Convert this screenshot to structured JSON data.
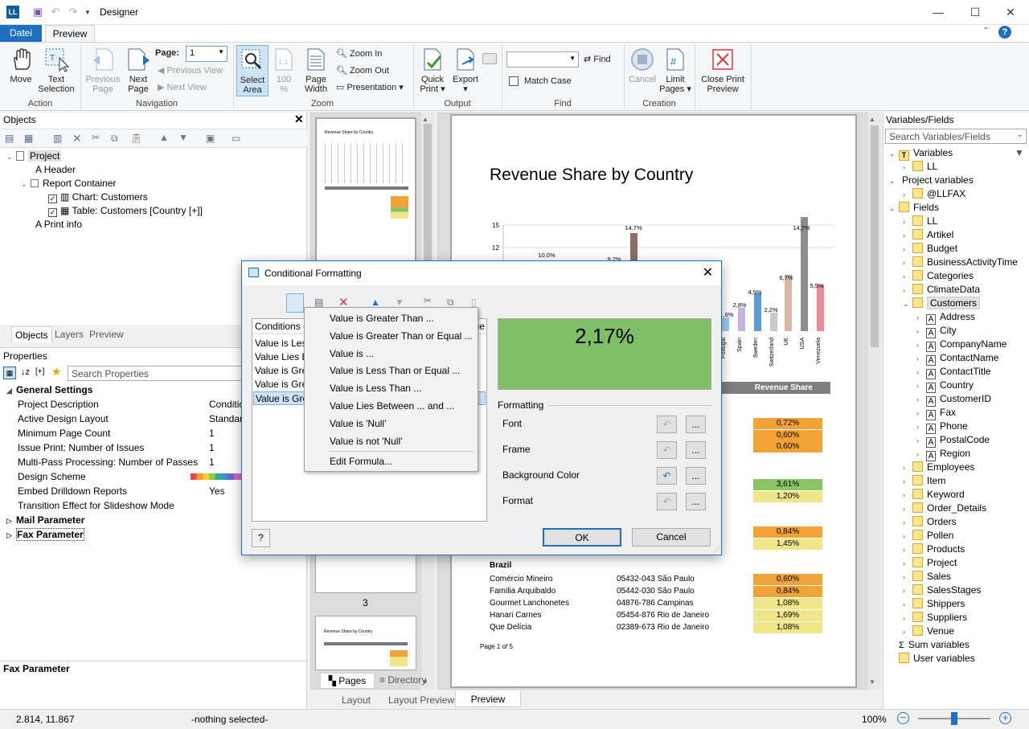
{
  "window": {
    "title": "Designer",
    "app_icon": "LL",
    "controls": [
      "—",
      "☐",
      "✕"
    ]
  },
  "ribbon_tabs": {
    "file": "Datei",
    "preview": "Preview"
  },
  "ribbon": {
    "move": "Move",
    "text_selection": [
      "Text",
      "Selection"
    ],
    "previous_page": [
      "Previous",
      "Page"
    ],
    "next_page": [
      "Next",
      "Page"
    ],
    "page_label": "Page:",
    "page_value": "1",
    "previous_view": "Previous View",
    "next_view": "Next View",
    "select_area": [
      "Select",
      "Area"
    ],
    "zoom100": [
      "100",
      "%"
    ],
    "page_width": [
      "Page",
      "Width"
    ],
    "zoom_in": "Zoom In",
    "zoom_out": "Zoom Out",
    "presentation": "Presentation ▾",
    "quick_print": [
      "Quick",
      "Print ▾"
    ],
    "export": [
      "Export",
      "▾"
    ],
    "find": "Find",
    "match_case": "Match Case",
    "cancel": "Cancel",
    "limit_pages": [
      "Limit",
      "Pages ▾"
    ],
    "close_print_preview": [
      "Close Print",
      "Preview"
    ],
    "groups": {
      "action": "Action",
      "navigation": "Navigation",
      "zoom": "Zoom",
      "output": "Output",
      "find": "Find",
      "creation": "Creation"
    }
  },
  "objects_panel": {
    "title": "Objects",
    "tree": [
      "Project",
      "Header",
      "Report Container",
      "Chart: Customers",
      "Table: Customers [Country [+]]",
      "Print info"
    ],
    "tabs": [
      "Objects",
      "Layers",
      "Preview"
    ]
  },
  "properties_panel": {
    "title": "Properties",
    "search_placeholder": "Search Properties",
    "group_general": "General Settings",
    "rows": [
      {
        "name": "Project Description",
        "value": "Conditional"
      },
      {
        "name": "Active Design Layout",
        "value": "Standard Lay"
      },
      {
        "name": "Minimum Page Count",
        "value": "1"
      },
      {
        "name": "Issue Print: Number of Issues",
        "value": "1"
      },
      {
        "name": "Multi-Pass Processing: Number of Passes",
        "value": "1"
      },
      {
        "name": "Design Scheme",
        "value": ""
      },
      {
        "name": "Embed Drilldown Reports",
        "value": "Yes"
      },
      {
        "name": "Transition Effect for Slideshow Mode",
        "value": ""
      }
    ],
    "group_mail": "Mail Parameter",
    "group_fax": "Fax Parameter",
    "description_title": "Fax Parameter"
  },
  "thumbs": {
    "page3_label": "3",
    "tabs": [
      "Pages",
      "Directory"
    ],
    "mini_title": "Revenue Share by Country"
  },
  "bottom_tabs": [
    "Layout",
    "Layout Preview",
    "Preview"
  ],
  "report": {
    "title": "Revenue Share by Country",
    "chart_data": {
      "type": "bar",
      "y_ticks": [
        "15",
        "12"
      ],
      "visible_categories": [
        "Portugal",
        "Spain",
        "Sweden",
        "Switzerland",
        "UK",
        "USA",
        "Venezuela"
      ],
      "visible_values": [
        1.6,
        2.8,
        4.5,
        2.2,
        6.7,
        14.7,
        5.5
      ],
      "labels": [
        "10,0%",
        "9,2%",
        "14,7%",
        "1,6%",
        "2,8%",
        "4,5%",
        "2,2%",
        "6,7%",
        "14,7%",
        "5,5%"
      ],
      "colors": [
        "#9ec8ea",
        "#c9b1e0",
        "#5b9bd5",
        "#c8c8c8",
        "#d9b7a3",
        "#8c8c8c",
        "#f08a96"
      ]
    },
    "table_header": "Revenue Share",
    "group_a_values": [
      "0,72%",
      "0,60%",
      "0,60%"
    ],
    "group_b_values": [
      "3,61%",
      "1,20%"
    ],
    "group_c_values": [
      "0,84%",
      "1,45%"
    ],
    "brazil": {
      "heading": "Brazil",
      "rows": [
        {
          "name": "Comércio Mineiro",
          "addr": "05432-043 São Paulo",
          "value": "0,60%"
        },
        {
          "name": "Familia Arquibaldo",
          "addr": "05442-030 São Paulo",
          "value": "0,84%"
        },
        {
          "name": "Gourmet Lanchonetes",
          "addr": "04876-786 Campinas",
          "value": "1,08%"
        },
        {
          "name": "Hanari Carnes",
          "addr": "05454-876 Rio de Janeiro",
          "value": "1,69%"
        },
        {
          "name": "Que Delícia",
          "addr": "02389-673 Rio de Janeiro",
          "value": "1,08%"
        }
      ]
    },
    "page_footer": "Page 1 of 5"
  },
  "variables_panel": {
    "title": "Variables/Fields",
    "search_placeholder": "Search Variables/Fields",
    "tree": [
      {
        "label": "Variables",
        "level": 0,
        "exp": "open",
        "kind": "T"
      },
      {
        "label": "LL",
        "level": 1,
        "exp": "closed",
        "kind": "f"
      },
      {
        "label": "Project variables",
        "level": 0,
        "exp": "open",
        "kind": "none"
      },
      {
        "label": "@LLFAX",
        "level": 1,
        "exp": "closed",
        "kind": "f"
      },
      {
        "label": "Fields",
        "level": 0,
        "exp": "open",
        "kind": "f"
      },
      {
        "label": "LL",
        "level": 1,
        "exp": "closed",
        "kind": "f"
      },
      {
        "label": "Artikel",
        "level": 1,
        "exp": "closed",
        "kind": "f"
      },
      {
        "label": "Budget",
        "level": 1,
        "exp": "closed",
        "kind": "f"
      },
      {
        "label": "BusinessActivityTime",
        "level": 1,
        "exp": "closed",
        "kind": "f"
      },
      {
        "label": "Categories",
        "level": 1,
        "exp": "closed",
        "kind": "f"
      },
      {
        "label": "ClimateData",
        "level": 1,
        "exp": "closed",
        "kind": "f"
      },
      {
        "label": "Customers",
        "level": 1,
        "exp": "open",
        "kind": "f",
        "selected": true
      },
      {
        "label": "Address",
        "level": 2,
        "exp": "closed",
        "kind": "A"
      },
      {
        "label": "City",
        "level": 2,
        "exp": "closed",
        "kind": "A"
      },
      {
        "label": "CompanyName",
        "level": 2,
        "exp": "closed",
        "kind": "A"
      },
      {
        "label": "ContactName",
        "level": 2,
        "exp": "closed",
        "kind": "A"
      },
      {
        "label": "ContactTitle",
        "level": 2,
        "exp": "closed",
        "kind": "A"
      },
      {
        "label": "Country",
        "level": 2,
        "exp": "closed",
        "kind": "A"
      },
      {
        "label": "CustomerID",
        "level": 2,
        "exp": "closed",
        "kind": "A"
      },
      {
        "label": "Fax",
        "level": 2,
        "exp": "closed",
        "kind": "A"
      },
      {
        "label": "Phone",
        "level": 2,
        "exp": "closed",
        "kind": "A"
      },
      {
        "label": "PostalCode",
        "level": 2,
        "exp": "closed",
        "kind": "A"
      },
      {
        "label": "Region",
        "level": 2,
        "exp": "closed",
        "kind": "A"
      },
      {
        "label": "Employees",
        "level": 1,
        "exp": "closed",
        "kind": "f"
      },
      {
        "label": "Item",
        "level": 1,
        "exp": "closed",
        "kind": "f"
      },
      {
        "label": "Keyword",
        "level": 1,
        "exp": "closed",
        "kind": "f"
      },
      {
        "label": "Order_Details",
        "level": 1,
        "exp": "closed",
        "kind": "f"
      },
      {
        "label": "Orders",
        "level": 1,
        "exp": "closed",
        "kind": "f"
      },
      {
        "label": "Pollen",
        "level": 1,
        "exp": "closed",
        "kind": "f"
      },
      {
        "label": "Products",
        "level": 1,
        "exp": "closed",
        "kind": "f"
      },
      {
        "label": "Project",
        "level": 1,
        "exp": "closed",
        "kind": "f"
      },
      {
        "label": "Sales",
        "level": 1,
        "exp": "closed",
        "kind": "f"
      },
      {
        "label": "SalesStages",
        "level": 1,
        "exp": "closed",
        "kind": "f"
      },
      {
        "label": "Shippers",
        "level": 1,
        "exp": "closed",
        "kind": "f"
      },
      {
        "label": "Suppliers",
        "level": 1,
        "exp": "closed",
        "kind": "f"
      },
      {
        "label": "Venue",
        "level": 1,
        "exp": "closed",
        "kind": "f"
      },
      {
        "label": "Sum variables",
        "level": 0,
        "exp": "none",
        "kind": "S"
      },
      {
        "label": "User variables",
        "level": 0,
        "exp": "none",
        "kind": "f"
      }
    ]
  },
  "dialog": {
    "title": "Conditional Formatting",
    "conditions_header": "Conditions (",
    "right_header_fragment": "ue",
    "conditions": [
      "Value is Less",
      "Value Lies Be",
      "Value is Grea",
      "Value is Grea",
      "Value is Grea"
    ],
    "preview_value": "2,17%",
    "formatting_label": "Formatting",
    "format_rows": [
      "Font",
      "Frame",
      "Background Color",
      "Format"
    ],
    "ellipsis": "...",
    "ok": "OK",
    "cancel": "Cancel",
    "help": "?"
  },
  "context_menu": {
    "items": [
      "Value is Greater Than ...",
      "Value is Greater Than or Equal ...",
      "Value is ...",
      "Value is Less Than or Equal ...",
      "Value is Less Than ...",
      "Value Lies Between ... and ...",
      "Value is 'Null'",
      "Value is not 'Null'"
    ],
    "formula": "Edit Formula..."
  },
  "status": {
    "coords": "2.814, 11.867",
    "selection": "-nothing selected-",
    "zoom": "100%"
  },
  "colors": {
    "accent": "#1e6fc0",
    "orange": "#f3a335",
    "yellow": "#f1e58a",
    "green": "#8bc464",
    "preview_green": "#7fbf66"
  }
}
